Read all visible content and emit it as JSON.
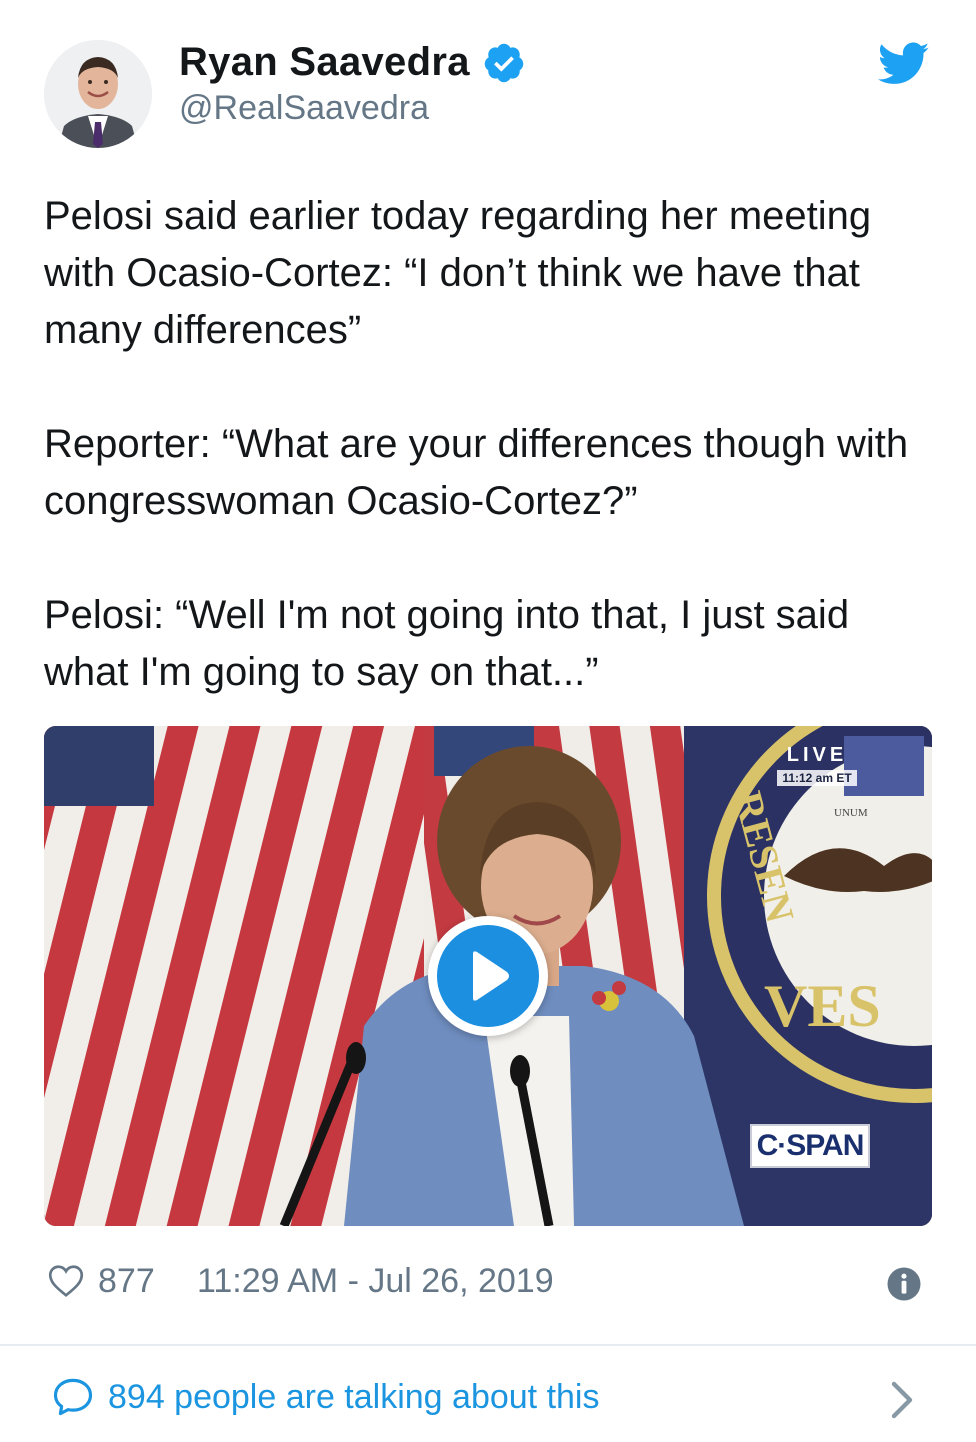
{
  "user": {
    "display_name": "Ryan Saavedra",
    "handle": "@RealSaavedra",
    "verified": true,
    "avatar_icon": "avatar"
  },
  "tweet": {
    "paragraphs": [
      "Pelosi said earlier today regarding her meeting with Ocasio-Cortez: “I don’t think we have that many differences”",
      "Reporter: “What are your differences though with congresswoman Ocasio-Cortez?”",
      "Pelosi: “Well I'm not going into that, I just said what I'm going to say on that...”"
    ]
  },
  "media": {
    "type": "video",
    "live_label": "LIVE",
    "live_time": "11:12 am ET",
    "network_label": "C·SPAN",
    "seal_text_top": "RESEN",
    "seal_text_bottom": "VES",
    "seal_small_text": "UNUM",
    "play_icon": "play-icon"
  },
  "meta": {
    "like_count": "877",
    "timestamp": "11:29 AM - Jul 26, 2019",
    "info_icon": "info-icon"
  },
  "footer": {
    "talking_text": "894 people are talking about this",
    "chevron_icon": "chevron-right-icon"
  },
  "colors": {
    "brand_blue": "#1da1f2",
    "link_blue": "#1b95e0",
    "secondary_text": "#657786",
    "primary_text": "#14171a"
  }
}
